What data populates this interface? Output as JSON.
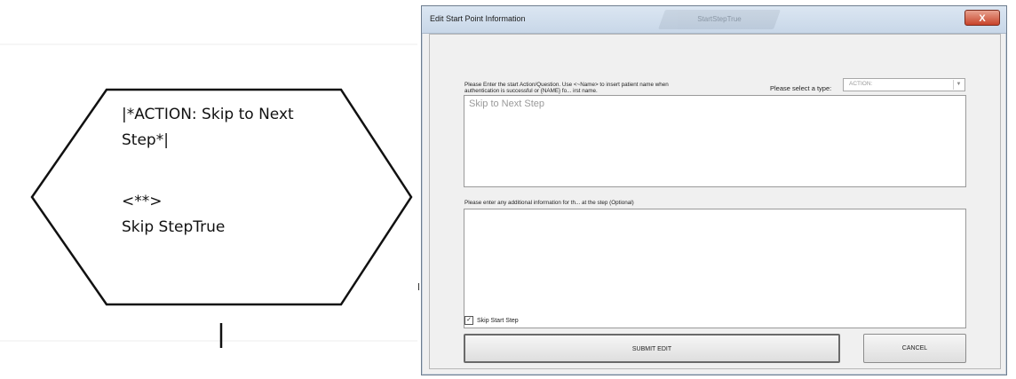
{
  "flowchart": {
    "node_lines": [
      "|*ACTION: Skip to Next",
      "Step*|",
      "",
      "<**>",
      "Skip StepTrue"
    ]
  },
  "dialog": {
    "title": "Edit Start Point Information",
    "background_caption": "StartStepTrue",
    "close_symbol": "X",
    "instructions_line1": "Please Enter the start Action/Question. Use <~Name> to insert patient name when",
    "instructions_line2": "authentication is successful or {NAME} fo... irst name.",
    "type_label": "Please select a type:",
    "type_value": "ACTION:",
    "start_text_value": "Skip to Next Step",
    "info_label": "Please enter any additional information for th... at the step (Optional)",
    "info_text_value": "",
    "skip_checkbox_label": "Skip Start Step",
    "skip_checked": true,
    "submit_label": "SUBMIT EDIT",
    "cancel_label": "CANCEL"
  }
}
